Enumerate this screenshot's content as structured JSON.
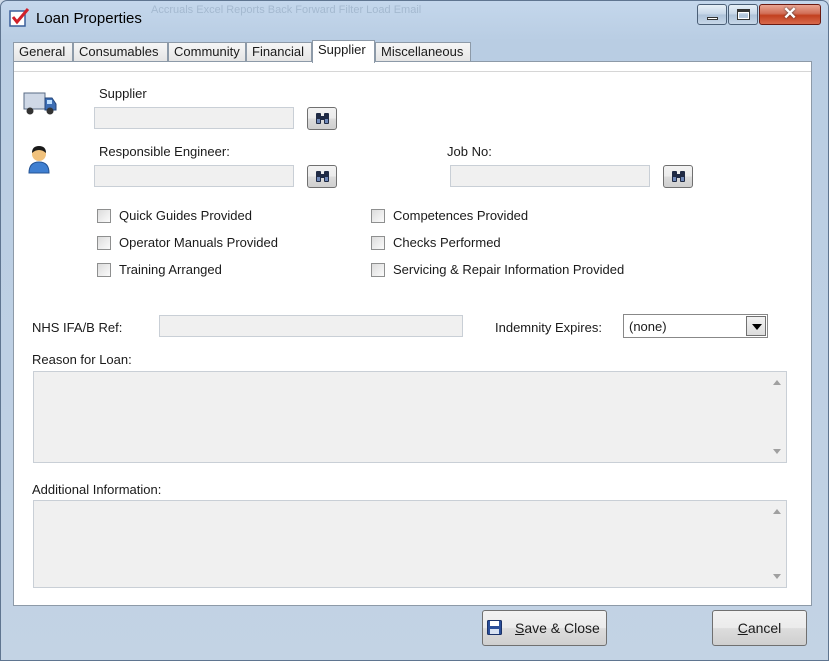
{
  "window": {
    "title": "Loan Properties",
    "background_ghost": "Accruals   Excel   Reports   Back   Forward   Filter   Load   Email",
    "close_glyph": "✕"
  },
  "tabs": [
    {
      "label": "General"
    },
    {
      "label": "Consumables"
    },
    {
      "label": "Community"
    },
    {
      "label": "Financial"
    },
    {
      "label": "Supplier",
      "active": true
    },
    {
      "label": "Miscellaneous"
    }
  ],
  "supplier": {
    "label": "Supplier",
    "value": "",
    "icon": "truck-icon"
  },
  "engineer": {
    "label": "Responsible Engineer:",
    "value": "",
    "icon": "person-icon"
  },
  "job": {
    "label": "Job No:",
    "value": ""
  },
  "checks_left": [
    {
      "label": "Quick Guides Provided",
      "checked": false
    },
    {
      "label": "Operator Manuals Provided",
      "checked": false
    },
    {
      "label": "Training Arranged",
      "checked": false
    }
  ],
  "checks_right": [
    {
      "label": "Competences Provided",
      "checked": false
    },
    {
      "label": "Checks Performed",
      "checked": false
    },
    {
      "label": "Servicing & Repair Information Provided",
      "checked": false
    }
  ],
  "nhs_ref": {
    "label": "NHS IFA/B Ref:",
    "value": ""
  },
  "indemnity": {
    "label": "Indemnity Expires:",
    "value": "(none)"
  },
  "reason": {
    "label": "Reason for Loan:",
    "value": ""
  },
  "additional": {
    "label": "Additional Information:",
    "value": ""
  },
  "footer": {
    "save_prefix": "",
    "save_accel": "S",
    "save_rest": "ave & Close",
    "cancel_accel": "C",
    "cancel_rest": "ancel"
  }
}
